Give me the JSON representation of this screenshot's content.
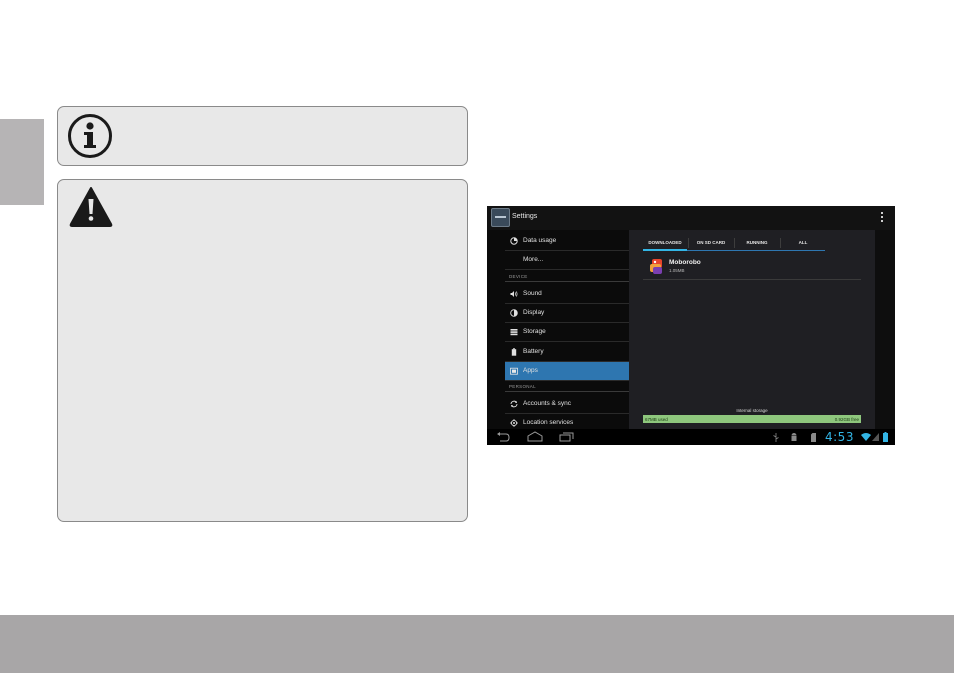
{
  "tablet": {
    "action_bar_title": "Settings",
    "settings_items": [
      {
        "label": "Data usage",
        "icon": "data-usage-icon"
      },
      {
        "label": "More...",
        "icon": ""
      },
      {
        "label": "Sound",
        "icon": "sound-icon"
      },
      {
        "label": "Display",
        "icon": "display-icon"
      },
      {
        "label": "Storage",
        "icon": "storage-icon"
      },
      {
        "label": "Battery",
        "icon": "battery-icon"
      },
      {
        "label": "Apps",
        "icon": "apps-icon",
        "selected": true
      },
      {
        "label": "Accounts & sync",
        "icon": "sync-icon"
      },
      {
        "label": "Location services",
        "icon": "location-icon"
      }
    ],
    "section_headers": {
      "device": "DEVICE",
      "personal": "PERSONAL"
    },
    "tabs": [
      "DOWNLOADED",
      "ON SD CARD",
      "RUNNING",
      "ALL"
    ],
    "active_tab": "DOWNLOADED",
    "app": {
      "name": "Moborobo",
      "size": "1.05MB"
    },
    "storage": {
      "label": "Internal storage",
      "used": "67MB used",
      "free": "0.92GB free",
      "used_fraction": 0.07
    },
    "clock": "4:53",
    "accent_color": "#33b5e5",
    "selected_color": "#2e76b0"
  },
  "boxes": {
    "info_icon": "info-icon",
    "warning_icon": "warning-icon",
    "box_color": "#e8e8e8"
  }
}
